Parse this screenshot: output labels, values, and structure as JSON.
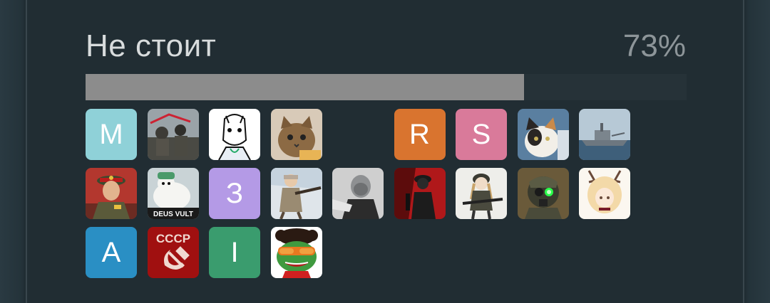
{
  "vote_option": {
    "label": "Не стоит",
    "percent_text": "73%",
    "percent_value": 0.73,
    "colors": {
      "bar_fill": "#8c8c8c",
      "bar_track": "#263238"
    }
  },
  "voters": [
    {
      "type": "letter",
      "letter": "M",
      "color": "#8fd1d8"
    },
    {
      "type": "image",
      "icon": "soldiers-photo-icon"
    },
    {
      "type": "image",
      "icon": "horse-doctor-icon"
    },
    {
      "type": "image",
      "icon": "cat-photo-icon"
    },
    {
      "type": "empty"
    },
    {
      "type": "letter",
      "letter": "R",
      "color": "#d9742f"
    },
    {
      "type": "letter",
      "letter": "S",
      "color": "#d97a9a"
    },
    {
      "type": "image",
      "icon": "calico-cat-icon"
    },
    {
      "type": "image",
      "icon": "warship-icon"
    },
    {
      "type": "image",
      "icon": "soviet-officer-icon"
    },
    {
      "type": "image",
      "icon": "polar-bear-deus-vult-icon",
      "caption": "DEUS VULT"
    },
    {
      "type": "letter",
      "letter": "З",
      "color": "#b49ae6"
    },
    {
      "type": "image",
      "icon": "winter-soldier-icon"
    },
    {
      "type": "image",
      "icon": "bald-character-icon"
    },
    {
      "type": "image",
      "icon": "red-soldier-icon"
    },
    {
      "type": "image",
      "icon": "anime-soldier-girl-icon"
    },
    {
      "type": "image",
      "icon": "gasmask-soldier-icon"
    },
    {
      "type": "image",
      "icon": "anime-antler-girl-icon"
    },
    {
      "type": "letter",
      "letter": "A",
      "color": "#2a8fc4"
    },
    {
      "type": "image",
      "icon": "cccp-icon",
      "caption": "СССР"
    },
    {
      "type": "letter",
      "letter": "I",
      "color": "#3a9c6e"
    },
    {
      "type": "image",
      "icon": "pepe-sunglasses-icon"
    }
  ]
}
